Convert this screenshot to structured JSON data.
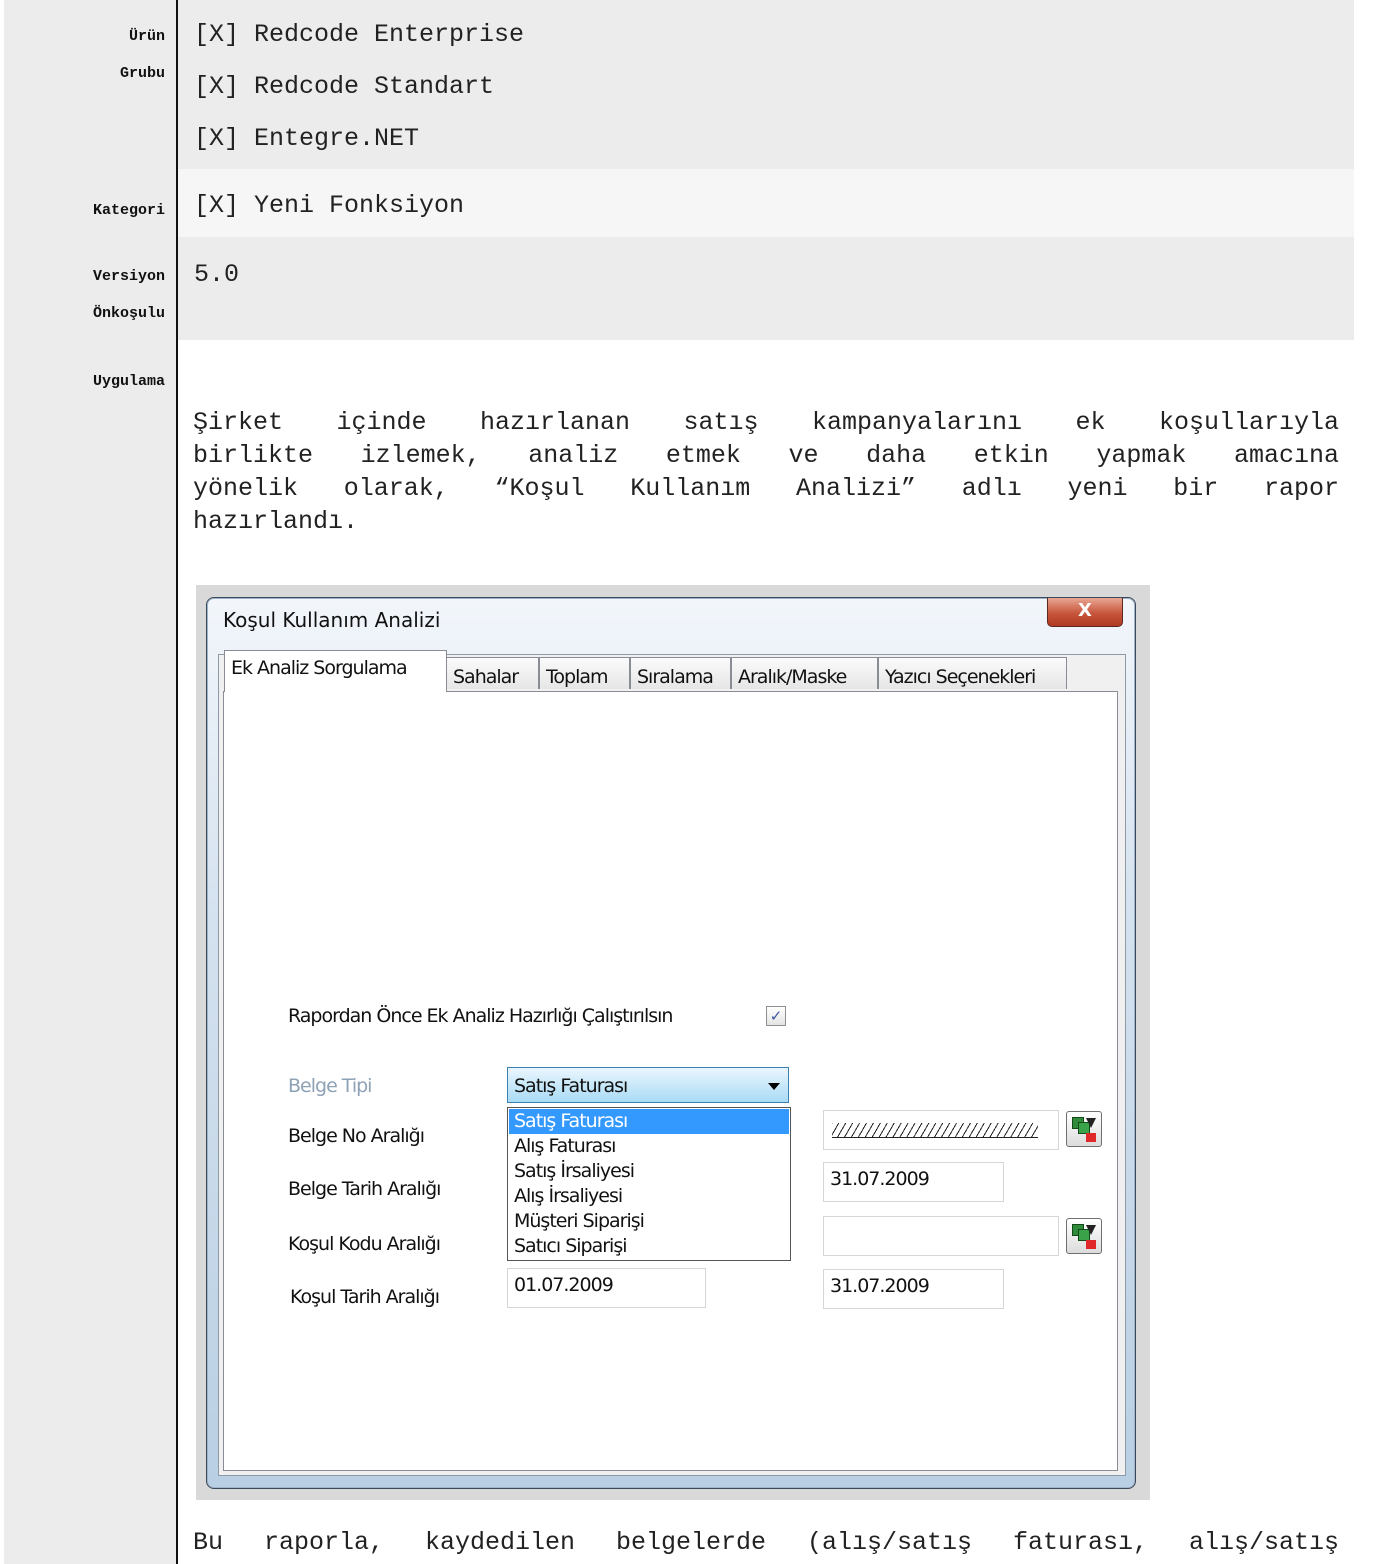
{
  "rows": [
    {
      "label_lines": [
        "Ürün",
        "Grubu"
      ],
      "values": [
        "[X] Redcode Enterprise",
        "[X] Redcode Standart",
        "[X] Entegre.NET"
      ]
    },
    {
      "label_lines": [
        "Kategori"
      ],
      "values": [
        "[X] Yeni Fonksiyon"
      ]
    },
    {
      "label_lines": [
        "Versiyon",
        "Önkoşulu"
      ],
      "values": [
        "5.0"
      ]
    },
    {
      "label_lines": [
        "Uygulama"
      ],
      "values": []
    }
  ],
  "paragraph_lines": [
    "Şirket içinde hazırlanan satış kampanyalarını ek koşullarıyla",
    "birlikte izlemek, analiz etmek ve daha etkin yapmak amacına",
    "yönelik olarak, “Koşul Kullanım Analizi” adlı yeni bir rapor",
    "hazırlandı."
  ],
  "bottom_text": "Bu raporla, kaydedilen belgelerde (alış/satış faturası, alış/satış",
  "dialog": {
    "title": "Koşul Kullanım Analizi",
    "close_label": "X",
    "tabs": [
      "Ek Analiz Sorgulama",
      "Sahalar",
      "Toplam",
      "Sıralama",
      "Aralık/Maske",
      "Yazıcı Seçenekleri"
    ],
    "active_tab": 0,
    "checkbox_label": "Rapordan Önce Ek Analiz Hazırlığı Çalıştırılsın",
    "checkbox_checked": true,
    "belge_tipi_label": "Belge Tipi",
    "belge_tipi_value": "Satış Faturası",
    "dropdown_options": [
      "Satış Faturası",
      "Alış Faturası",
      "Satış İrsaliyesi",
      "Alış İrsaliyesi",
      "Müşteri Siparişi",
      "Satıcı Siparişi"
    ],
    "dropdown_selected_index": 0,
    "belge_no_label": "Belge No Aralığı",
    "belge_tarih_label": "Belge Tarih Aralığı",
    "belge_tarih_end": "31.07.2009",
    "kosul_kodu_label": "Koşul Kodu Aralığı",
    "kosul_tarih_label": "Koşul Tarih Aralığı",
    "kosul_tarih_start": "01.07.2009",
    "kosul_tarih_end": "31.07.2009"
  },
  "colors": {
    "label_column_bg": "#ececec",
    "band_gray": "#ececec",
    "band_light": "#f6f6f6",
    "selection_blue": "#3399ff",
    "disabled_label": "#8ea2b6"
  }
}
